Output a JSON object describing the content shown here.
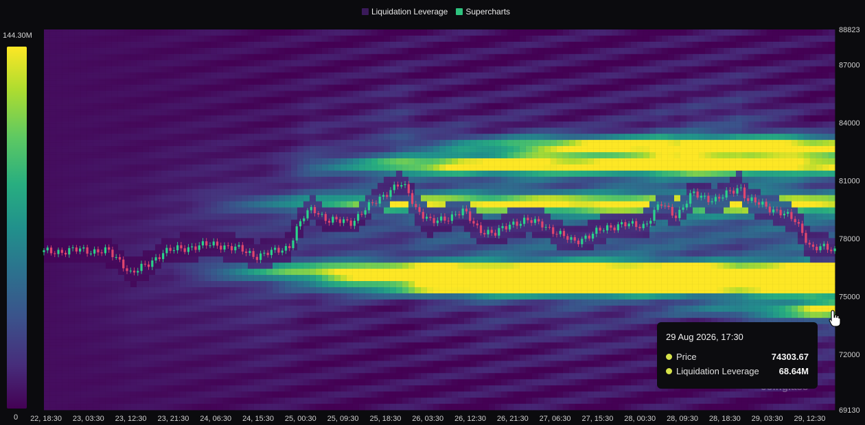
{
  "legend": [
    {
      "label": "Liquidation Leverage",
      "color": "#3a1a5a"
    },
    {
      "label": "Supercharts",
      "color": "#2ec27e"
    }
  ],
  "colorbar": {
    "max_label": "144.30M",
    "min_label": "0"
  },
  "chart_data": {
    "type": "heatmap",
    "title": "",
    "series": [
      {
        "name": "Liquidation Leverage",
        "kind": "heatmap"
      },
      {
        "name": "Supercharts",
        "kind": "candlestick"
      }
    ],
    "y_axis": {
      "min": 69130,
      "max": 88823,
      "ticks": [
        88823,
        87000,
        84000,
        81000,
        78000,
        75000,
        72000,
        69130
      ]
    },
    "x_axis": {
      "ticks": [
        "22, 18:30",
        "23, 03:30",
        "23, 12:30",
        "23, 21:30",
        "24, 06:30",
        "24, 15:30",
        "25, 00:30",
        "25, 09:30",
        "25, 18:30",
        "26, 03:30",
        "26, 12:30",
        "26, 21:30",
        "27, 06:30",
        "27, 15:30",
        "28, 00:30",
        "28, 09:30",
        "28, 18:30",
        "29, 03:30",
        "29, 12:30"
      ]
    },
    "price_path": [
      [
        0,
        77300
      ],
      [
        0.04,
        77400
      ],
      [
        0.08,
        77350
      ],
      [
        0.1,
        76700
      ],
      [
        0.11,
        76200
      ],
      [
        0.13,
        76600
      ],
      [
        0.15,
        77300
      ],
      [
        0.19,
        77600
      ],
      [
        0.22,
        77700
      ],
      [
        0.25,
        77400
      ],
      [
        0.27,
        77100
      ],
      [
        0.29,
        77300
      ],
      [
        0.31,
        77600
      ],
      [
        0.32,
        78500
      ],
      [
        0.33,
        79200
      ],
      [
        0.34,
        79600
      ],
      [
        0.36,
        78900
      ],
      [
        0.39,
        78900
      ],
      [
        0.41,
        79600
      ],
      [
        0.43,
        80300
      ],
      [
        0.45,
        80800
      ],
      [
        0.46,
        80500
      ],
      [
        0.47,
        79600
      ],
      [
        0.49,
        78800
      ],
      [
        0.51,
        79100
      ],
      [
        0.53,
        79400
      ],
      [
        0.55,
        78500
      ],
      [
        0.57,
        78200
      ],
      [
        0.59,
        78800
      ],
      [
        0.61,
        78900
      ],
      [
        0.63,
        78800
      ],
      [
        0.65,
        78200
      ],
      [
        0.67,
        77900
      ],
      [
        0.69,
        78100
      ],
      [
        0.71,
        78600
      ],
      [
        0.73,
        78700
      ],
      [
        0.76,
        78700
      ],
      [
        0.78,
        79800
      ],
      [
        0.8,
        79200
      ],
      [
        0.82,
        80300
      ],
      [
        0.85,
        80000
      ],
      [
        0.86,
        80200
      ],
      [
        0.88,
        80700
      ],
      [
        0.89,
        80000
      ],
      [
        0.91,
        79700
      ],
      [
        0.93,
        79400
      ],
      [
        0.95,
        78900
      ],
      [
        0.96,
        78300
      ],
      [
        0.97,
        77500
      ],
      [
        0.99,
        77500
      ],
      [
        1.0,
        77400
      ]
    ],
    "heat_bands": [
      {
        "price": 82800,
        "intensity": 0.9,
        "start": 0.55
      },
      {
        "price": 81800,
        "intensity": 0.85,
        "start": 0.4
      },
      {
        "price": 79800,
        "intensity": 0.7,
        "start": 0.3
      },
      {
        "price": 76300,
        "intensity": 1.0,
        "start": 0.28
      },
      {
        "price": 75500,
        "intensity": 0.95,
        "start": 0.4
      },
      {
        "price": 74300,
        "intensity": 0.75,
        "start": 0.85
      }
    ]
  },
  "tooltip": {
    "date": "29 Aug 2026, 17:30",
    "rows": [
      {
        "label": "Price",
        "value": "74303.67"
      },
      {
        "label": "Liquidation Leverage",
        "value": "68.64M"
      }
    ]
  },
  "watermark": "coinglass",
  "icons": {
    "cursor": "hand-pointer-icon"
  }
}
